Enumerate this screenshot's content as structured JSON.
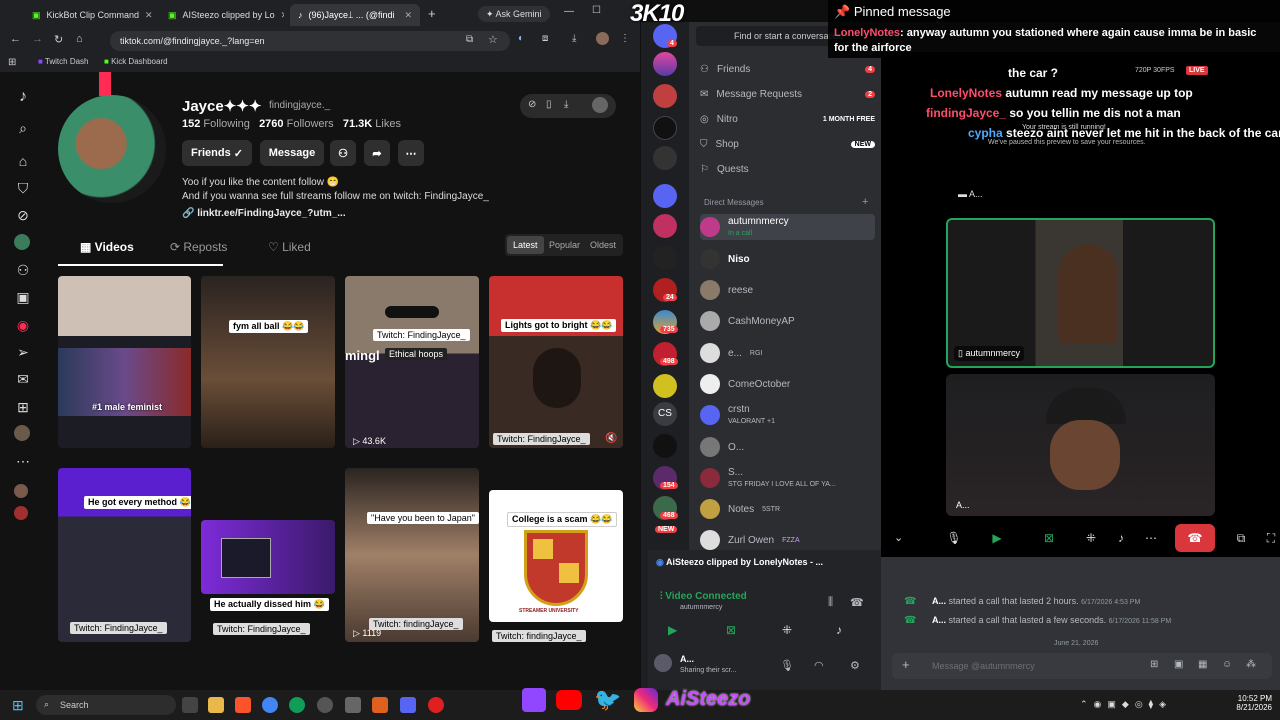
{
  "chrome": {
    "tabs": [
      "KickBot Clip Command",
      "AISteezo clipped by Lo",
      "(96)Jayce⟘ ... (@findi"
    ],
    "ask_gemini": "Ask Gemini",
    "url": "tiktok.com/@findingjayce._?lang=en",
    "bookmarks": [
      "Twitch Dash",
      "Kick Dashboard"
    ]
  },
  "profile": {
    "name": "Jayce✦✦✦",
    "username": "findingjayce._",
    "following_count": "152",
    "following_label": "Following",
    "followers_count": "2760",
    "followers_label": "Followers",
    "likes_count": "71.3K",
    "likes_label": "Likes",
    "friends_btn": "Friends",
    "message_btn": "Message",
    "bio_line1": "Yoo if you like the content follow 😁",
    "bio_line2": "And if you wanna see full streams follow me on twitch: FindingJayce_",
    "link": "linktr.ee/FindingJayce_?utm_...",
    "tabs": [
      "Videos",
      "Reposts",
      "Liked"
    ],
    "sort": [
      "Latest",
      "Popular",
      "Oldest"
    ]
  },
  "videos": {
    "captions": [
      "#1 male feminist",
      "fym all ball 😂😂",
      "Twitch: FindingJayce_",
      "Ethical hoops",
      "Lights got to bright 😂😂",
      "Twitch: FindingJayce_",
      "He got every method 😂😂",
      "He actually dissed him 😂",
      "\"Have you been to Japan\"",
      "College is a scam 😂😂",
      "Twitch: FindingJayce_",
      "Twitch: FindingJayce_",
      "Twitch: findingJayce_"
    ],
    "views": [
      "43.6K",
      "1119"
    ],
    "mingl_text": "mingl",
    "seal_top": "STREAMER UNIVERSITY"
  },
  "overlay": {
    "counter": "3K10",
    "pinned_title": "Pinned message",
    "pinned_user": "LonelyNotes",
    "pinned_text": "anyway autumn you stationed where again cause imma be in basic for the airforce",
    "messages": [
      {
        "user": "",
        "text": "the car ?"
      },
      {
        "user": "LonelyNotes",
        "text": "autumn read my message up top"
      },
      {
        "user": "findingJayce_",
        "text": "so you tellin me dis not a man"
      },
      {
        "user": "cypha",
        "text": "steezo aint never let me hit in the back of the car :("
      }
    ],
    "stream_status": "Your stream is still running!",
    "stream_sub": "We've paused this preview to save your resources.",
    "live_badge": "LIVE",
    "quality": "720P 30FPS"
  },
  "discord": {
    "search": "Find or start a conversation",
    "nav": [
      "Friends",
      "Message Requests",
      "Nitro",
      "Shop",
      "Quests"
    ],
    "nav_badges": [
      "4",
      "2",
      "1 MONTH FREE",
      "NEW"
    ],
    "dm_header": "Direct Messages",
    "dms": [
      {
        "name": "autumnmercy",
        "sub": "In a call"
      },
      {
        "name": "Niso",
        "sub": ""
      },
      {
        "name": "reese",
        "sub": ""
      },
      {
        "name": "CashMoneyAP",
        "sub": ""
      },
      {
        "name": "e...",
        "sub": "RGI"
      },
      {
        "name": "ComeOctober",
        "sub": ""
      },
      {
        "name": "crstn",
        "sub": "VALORANT +1"
      },
      {
        "name": "O...",
        "sub": ""
      },
      {
        "name": "S...",
        "sub": "STG FRIDAY I LOVE ALL OF YA..."
      },
      {
        "name": "Notes",
        "sub": "5STR"
      },
      {
        "name": "Zurl Owen",
        "sub": "FZZA"
      }
    ],
    "server_badges": [
      "4",
      "24",
      "735",
      "498",
      "154",
      "468"
    ],
    "new_badge": "NEW",
    "clip_notice": "AiSteezo clipped by LonelyNotes - ...",
    "video_connected": "Video Connected",
    "connected_user": "autumnmercy",
    "self_name": "A...",
    "self_status": "Sharing their scr...",
    "call_tile1": "autumnmercy",
    "call_tile2": "A...",
    "call_top": "A...",
    "history": [
      {
        "user": "A...",
        "text": "started a call that lasted 2 hours.",
        "time": "6/17/2026 4:53 PM"
      },
      {
        "user": "A...",
        "text": "started a call that lasted a few seconds.",
        "time": "6/17/2026 11:58 PM"
      }
    ],
    "date_divider": "June 21, 2026",
    "composer": "Message @autumnmercy"
  },
  "taskbar": {
    "search": "Search",
    "brand": "AiSteezo",
    "time": "10:52 PM",
    "date": "8/21/2026"
  }
}
